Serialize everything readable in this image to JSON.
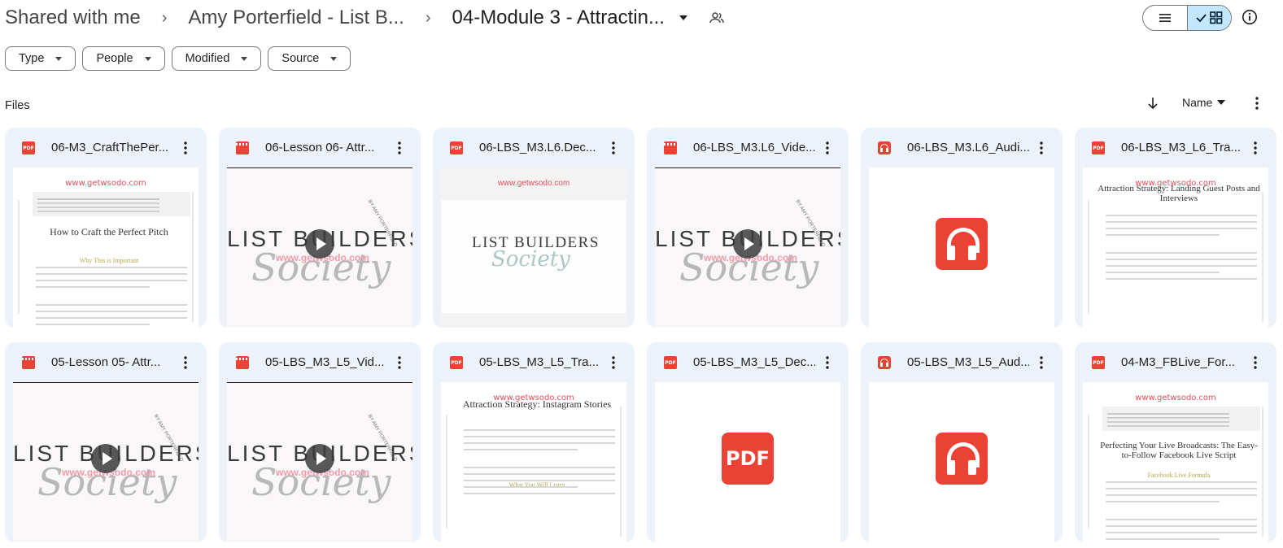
{
  "breadcrumb": [
    {
      "label": "Shared with me"
    },
    {
      "label": "Amy Porterfield - List B..."
    },
    {
      "label": "04-Module 3 - Attractin..."
    }
  ],
  "filters": [
    "Type",
    "People",
    "Modified",
    "Source"
  ],
  "section_label": "Files",
  "sort": {
    "label": "Name"
  },
  "files": [
    {
      "name": "06-M3_CraftThePer...",
      "type": "pdf",
      "preview": "doc"
    },
    {
      "name": "06-Lesson 06- Attr...",
      "type": "video",
      "preview": "lbs"
    },
    {
      "name": "06-LBS_M3.L6.Dec...",
      "type": "pdf",
      "preview": "decor"
    },
    {
      "name": "06-LBS_M3.L6_Vide...",
      "type": "video",
      "preview": "lbs"
    },
    {
      "name": "06-LBS_M3.L6_Audi...",
      "type": "audio",
      "preview": "audio"
    },
    {
      "name": "06-LBS_M3_L6_Tra...",
      "type": "pdf",
      "preview": "doc"
    },
    {
      "name": "05-Lesson 05- Attr...",
      "type": "video",
      "preview": "lbs"
    },
    {
      "name": "05-LBS_M3_L5_Vid...",
      "type": "video",
      "preview": "lbs"
    },
    {
      "name": "05-LBS_M3_L5_Tra...",
      "type": "pdf",
      "preview": "doc"
    },
    {
      "name": "05-LBS_M3_L5_Dec...",
      "type": "pdf",
      "preview": "pdfbig"
    },
    {
      "name": "05-LBS_M3_L5_Aud...",
      "type": "audio",
      "preview": "audio"
    },
    {
      "name": "04-M3_FBLive_For...",
      "type": "pdf",
      "preview": "doc"
    }
  ],
  "previews": {
    "doc_watermark": "www.getwsodo.com",
    "doc_titles": [
      {
        "title": "How to Craft the Perfect Pitch",
        "sub": "Why This is Important"
      },
      {
        "title": "Attraction Strategy: Landing Guest Posts and Interviews",
        "sub": ""
      },
      {
        "title": "Attraction Strategy: Instagram Stories",
        "sub": "What You Will Learn"
      },
      {
        "title": "Perfecting Your Live Broadcasts: The Easy-to-Follow Facebook Live Script",
        "sub": "Facebook Live Formula"
      }
    ],
    "lbs_big": "LIST BUILDERS",
    "lbs_script": "Society",
    "lbs_watermark": "www.getwsodo.com",
    "lbs_by": "BY AMY PORTERFIELD",
    "pdf_big": "PDF"
  }
}
